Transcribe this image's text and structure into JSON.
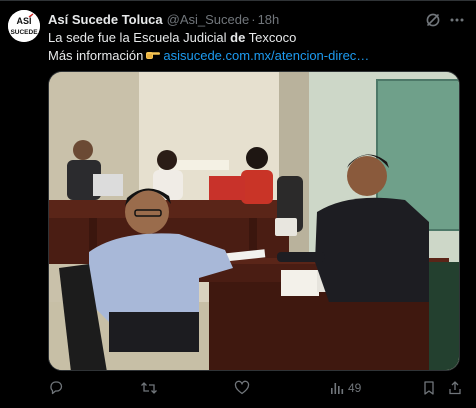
{
  "tweet": {
    "author": {
      "display_name": "Así Sucede Toluca",
      "handle": "@Asi_Sucede",
      "avatar_text_top": "ASÍ",
      "avatar_text_bottom": "SUCEDE"
    },
    "separator": "·",
    "time": "18h",
    "text": {
      "line1_before": "La sede fue la Escuela Judicial ",
      "line1_bold": "de",
      "line1_after": " Texcoco",
      "line2": "Más información",
      "link": "asisucede.com.mx/atencion-direc…"
    },
    "metrics": {
      "views": "49"
    }
  },
  "colors": {
    "background": "#000000",
    "primary_text": "#e7e9ea",
    "secondary_text": "#71767b",
    "link": "#1d9bf0",
    "border": "#2f3336"
  },
  "icons": {
    "grok": "grok-icon",
    "more": "more-icon",
    "reply": "reply-icon",
    "retweet": "retweet-icon",
    "like": "like-icon",
    "views": "views-icon",
    "bookmark": "bookmark-icon",
    "share": "share-icon",
    "pointing": "pointing-hand-icon"
  }
}
